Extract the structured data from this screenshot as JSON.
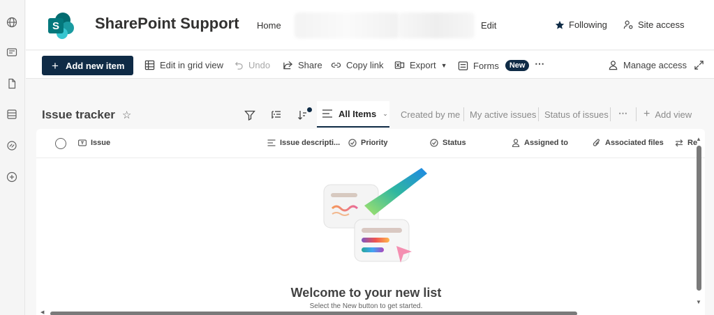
{
  "colors": {
    "accent": "#0f2b46",
    "logo": "#038387"
  },
  "rail": {
    "icons": [
      "globe-icon",
      "news-icon",
      "document-icon",
      "database-icon",
      "link-icon",
      "add-circle-icon"
    ]
  },
  "header": {
    "logo_letter": "S",
    "site_title": "SharePoint Support",
    "nav": {
      "home": "Home",
      "edit": "Edit"
    },
    "following": "Following",
    "site_access": "Site access"
  },
  "toolbar": {
    "add_new_item": "Add new item",
    "edit_grid": "Edit in grid view",
    "undo": "Undo",
    "share": "Share",
    "copy_link": "Copy link",
    "export": "Export",
    "forms": "Forms",
    "new_badge": "New",
    "more": "⋯",
    "manage_access": "Manage access"
  },
  "view": {
    "list_title": "Issue tracker",
    "active_view": "All Items",
    "tabs": [
      "Created by me",
      "My active issues",
      "Status of issues"
    ],
    "more": "⋯",
    "add_view": "Add view"
  },
  "columns": [
    "Issue",
    "Issue descripti...",
    "Priority",
    "Status",
    "Assigned to",
    "Associated files",
    "Re"
  ],
  "empty": {
    "title": "Welcome to your new list",
    "subtitle": "Select the New button to get started."
  }
}
